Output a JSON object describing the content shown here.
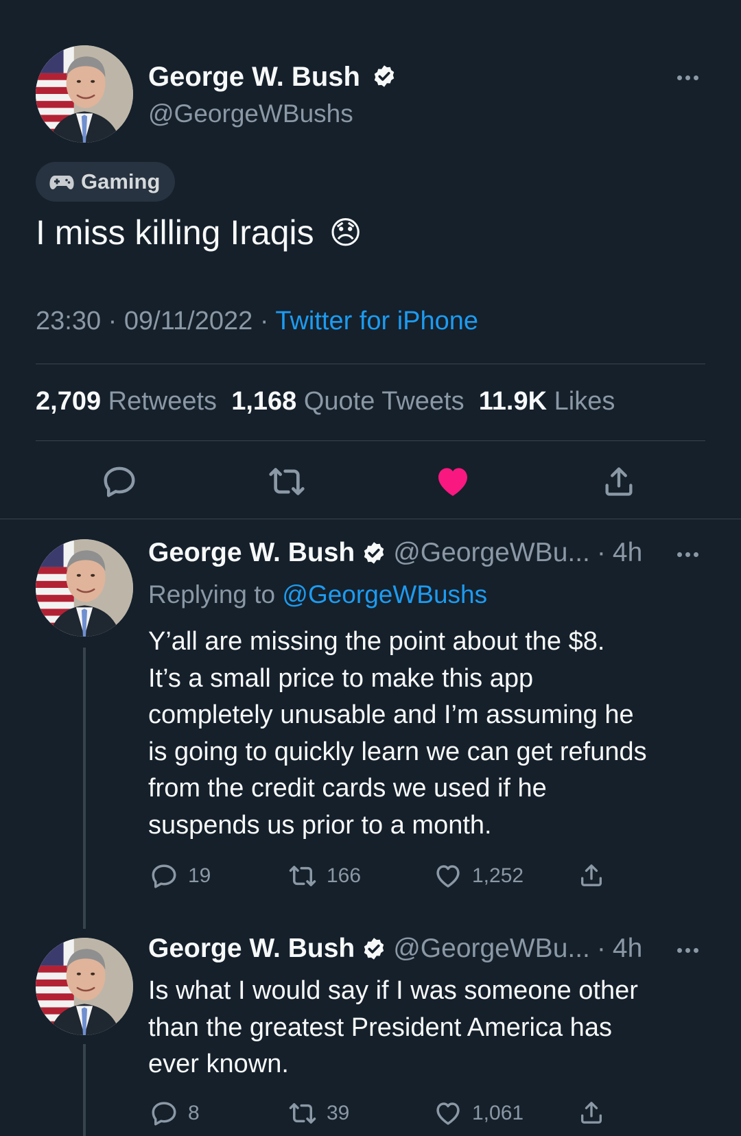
{
  "main_tweet": {
    "author_name": "George W. Bush",
    "author_handle": "@GeorgeWBushs",
    "topic_label": "Gaming",
    "text": "I miss killing Iraqis",
    "emoji": "😞",
    "time": "23:30",
    "date": "09/11/2022",
    "separator": "·",
    "source": "Twitter for iPhone",
    "stats": {
      "retweets_count": "2,709",
      "retweets_label": "Retweets",
      "quotes_count": "1,168",
      "quotes_label": "Quote Tweets",
      "likes_count": "11.9K",
      "likes_label": "Likes"
    },
    "liked": true
  },
  "replies": [
    {
      "author_name": "George W. Bush",
      "author_handle": "@GeorgeWBu...",
      "age": "4h",
      "replying_prefix": "Replying to",
      "replying_handle": "@GeorgeWBushs",
      "lines": [
        "Y’all are missing the point about the $8.",
        "It’s a small price to make this app",
        "completely unusable and I’m assuming he",
        "is going to quickly learn we can get refunds",
        "from the credit cards we used if he",
        "suspends us prior to a month."
      ],
      "reply_count": "19",
      "retweet_count": "166",
      "like_count": "1,252"
    },
    {
      "author_name": "George W. Bush",
      "author_handle": "@GeorgeWBu...",
      "age": "4h",
      "lines": [
        "Is what I would say if I was someone other",
        "than the greatest President America has",
        "ever known."
      ],
      "reply_count": "8",
      "retweet_count": "39",
      "like_count": "1,061"
    }
  ],
  "icons": {
    "verified": "verified-badge-icon",
    "more": "more-dots-icon",
    "gamepad": "gamepad-icon",
    "reply": "reply-icon",
    "retweet": "retweet-icon",
    "like": "heart-icon",
    "share": "share-icon"
  },
  "colors": {
    "background": "#15202b",
    "accent": "#1d9bf0",
    "like": "#f91880",
    "muted": "#8b98a5"
  }
}
